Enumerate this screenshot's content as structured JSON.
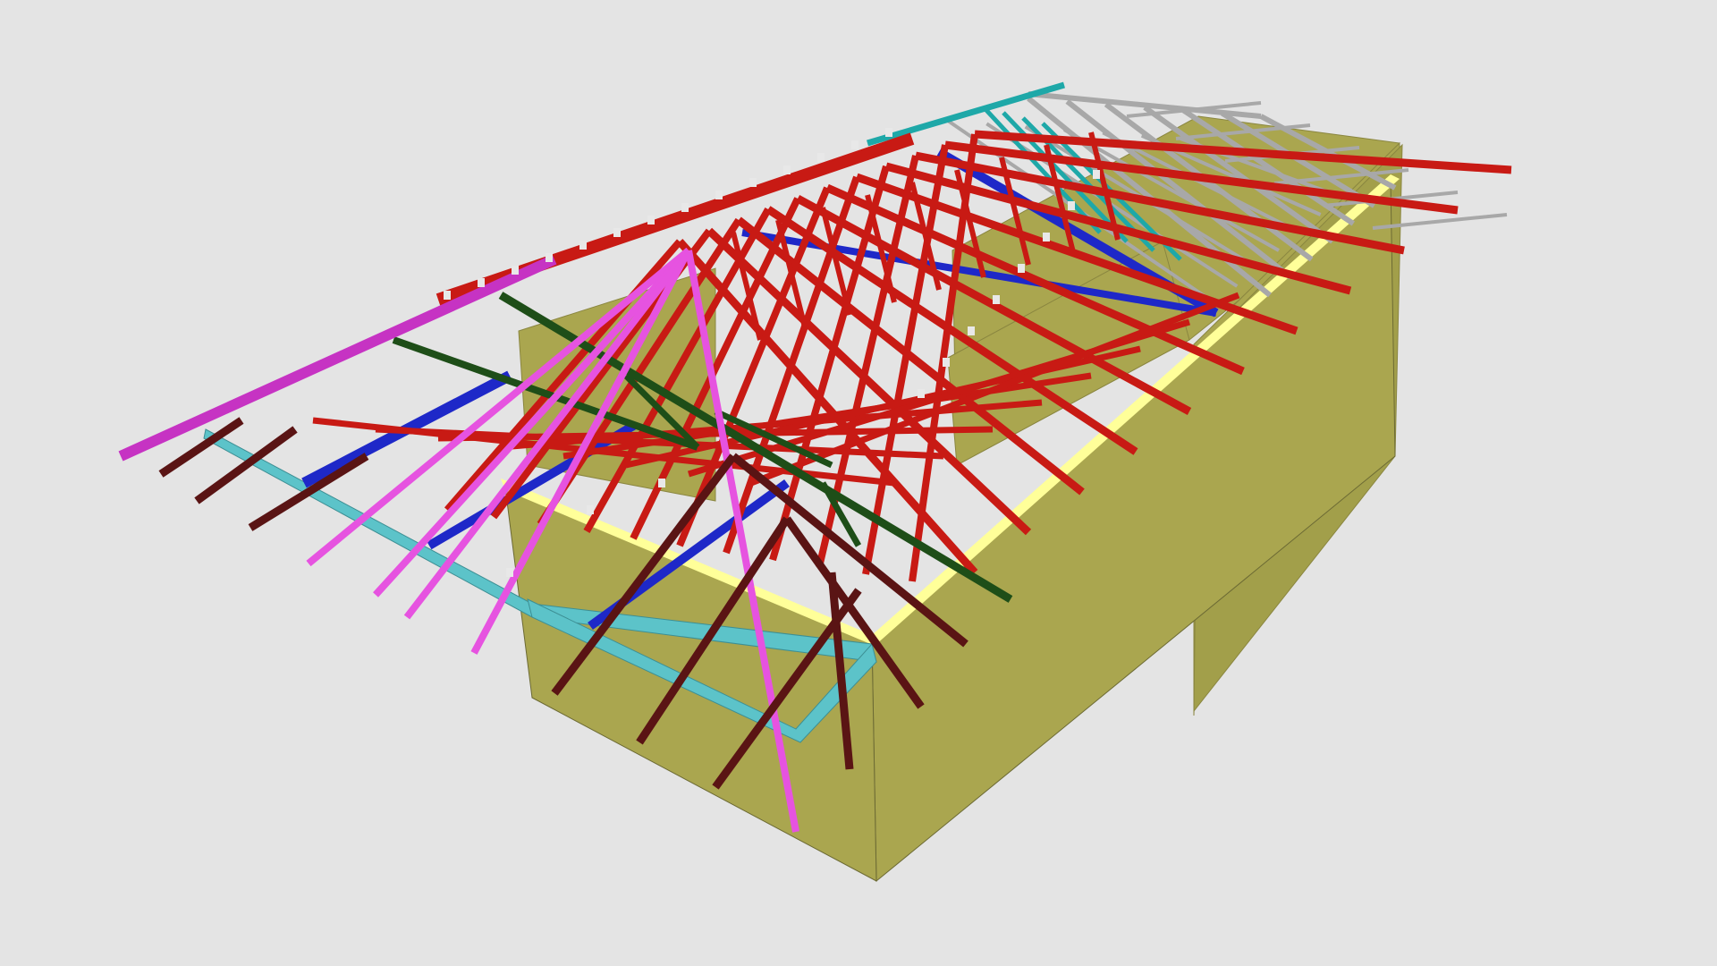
{
  "colors": {
    "background": "#e4e4e4",
    "wall_face": "#aaa64f",
    "wall_top": "#ffff99",
    "plate": "#5cc3c9",
    "red": "#c81a14",
    "magenta": "#c633c3",
    "pink": "#e653e0",
    "blue": "#1e28c8",
    "dark_green": "#1e4e18",
    "dark_brown": "#5a1414",
    "teal": "#1ea8a8",
    "grey": "#a8a8a8",
    "connector": "#e8e8e8"
  },
  "members": [
    "wall-frame",
    "wall-top-plate",
    "hip-rafter",
    "jack-truss",
    "girder-truss",
    "common-truss",
    "gable-truss",
    "jack-rafter",
    "ridge-truss",
    "standard-truss"
  ]
}
